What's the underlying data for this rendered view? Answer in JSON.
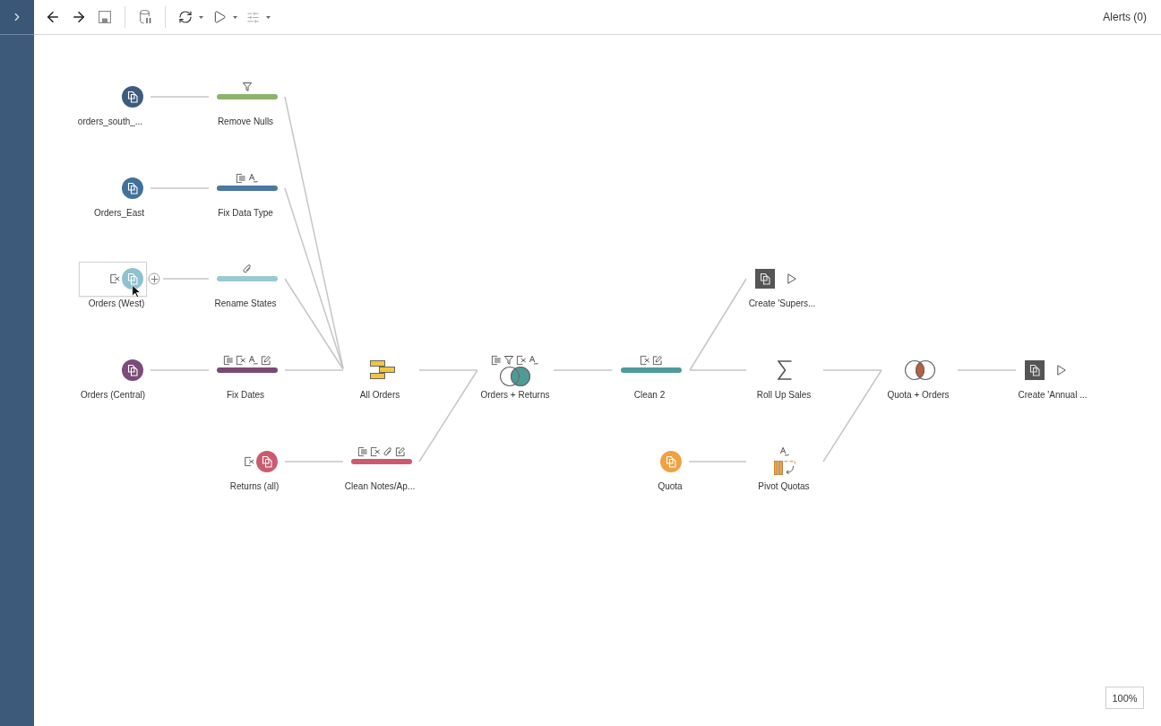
{
  "toolbar": {
    "alerts": "Alerts (0)"
  },
  "flow": {
    "nodes": [
      {
        "label": "orders_south_...",
        "kind": "input",
        "color": "#3d5b7e",
        "selected": false
      },
      {
        "label": "Remove Nulls",
        "kind": "clean",
        "color": "#8db26b",
        "selected": false,
        "changes": [
          {
            "kind": "filter"
          }
        ]
      },
      {
        "label": "Orders_East",
        "kind": "input",
        "color": "#41719b",
        "selected": false
      },
      {
        "label": "Fix Data Type",
        "kind": "clean",
        "color": "#4a78a3",
        "selected": false,
        "changes": [
          {
            "kind": "columns"
          },
          {
            "kind": "type"
          }
        ]
      },
      {
        "label": "Orders (West)",
        "kind": "input",
        "color": "#8ec2cd",
        "selected": true,
        "changes": [
          {
            "kind": "remove"
          }
        ]
      },
      {
        "label": "Rename States",
        "kind": "clean",
        "color": "#9ac9d4",
        "selected": false,
        "changes": [
          {
            "kind": "group"
          }
        ]
      },
      {
        "label": "Create 'Supers...",
        "kind": "output",
        "color": "#555555",
        "selected": false
      },
      {
        "label": "Orders (Central)",
        "kind": "input",
        "color": "#7a4c78",
        "selected": false
      },
      {
        "label": "Fix Dates",
        "kind": "clean",
        "color": "#7a4a73",
        "selected": false,
        "changes": [
          {
            "kind": "columns"
          },
          {
            "kind": "remove"
          },
          {
            "kind": "type"
          },
          {
            "kind": "edit"
          }
        ]
      },
      {
        "label": "All Orders",
        "kind": "union",
        "color": "#f2c443",
        "selected": false
      },
      {
        "label": "Orders + Returns",
        "kind": "join",
        "left_only": false,
        "matched": true,
        "right_only": true,
        "color": "#4e9a98",
        "selected": false,
        "changes": [
          {
            "kind": "columns"
          },
          {
            "kind": "filter"
          },
          {
            "kind": "remove"
          },
          {
            "kind": "type"
          }
        ]
      },
      {
        "label": "Clean 2",
        "kind": "clean",
        "color": "#4f9b98",
        "selected": false,
        "changes": [
          {
            "kind": "remove"
          },
          {
            "kind": "edit"
          }
        ]
      },
      {
        "label": "Roll Up Sales",
        "kind": "aggregate",
        "selected": false
      },
      {
        "label": "Quota + Orders",
        "kind": "join",
        "left_only": false,
        "matched": true,
        "right_only": false,
        "color": "#b5603f",
        "selected": false
      },
      {
        "label": "Create 'Annual ...",
        "kind": "output",
        "color": "#555555",
        "selected": false
      },
      {
        "label": "Returns (all)",
        "kind": "input",
        "color": "#cc5a6e",
        "selected": false,
        "changes": [
          {
            "kind": "remove"
          }
        ]
      },
      {
        "label": "Clean Notes/Ap...",
        "kind": "clean",
        "color": "#cc5a6e",
        "selected": false,
        "changes": [
          {
            "kind": "columns"
          },
          {
            "kind": "remove"
          },
          {
            "kind": "group"
          },
          {
            "kind": "edit"
          }
        ]
      },
      {
        "label": "Quota",
        "kind": "input",
        "color": "#f0a140",
        "selected": false
      },
      {
        "label": "Pivot Quotas",
        "kind": "pivot",
        "color": "#f0a140",
        "selected": false,
        "changes": [
          {
            "kind": "type"
          }
        ]
      }
    ]
  },
  "zoom_indicator": {
    "text": "100%"
  }
}
